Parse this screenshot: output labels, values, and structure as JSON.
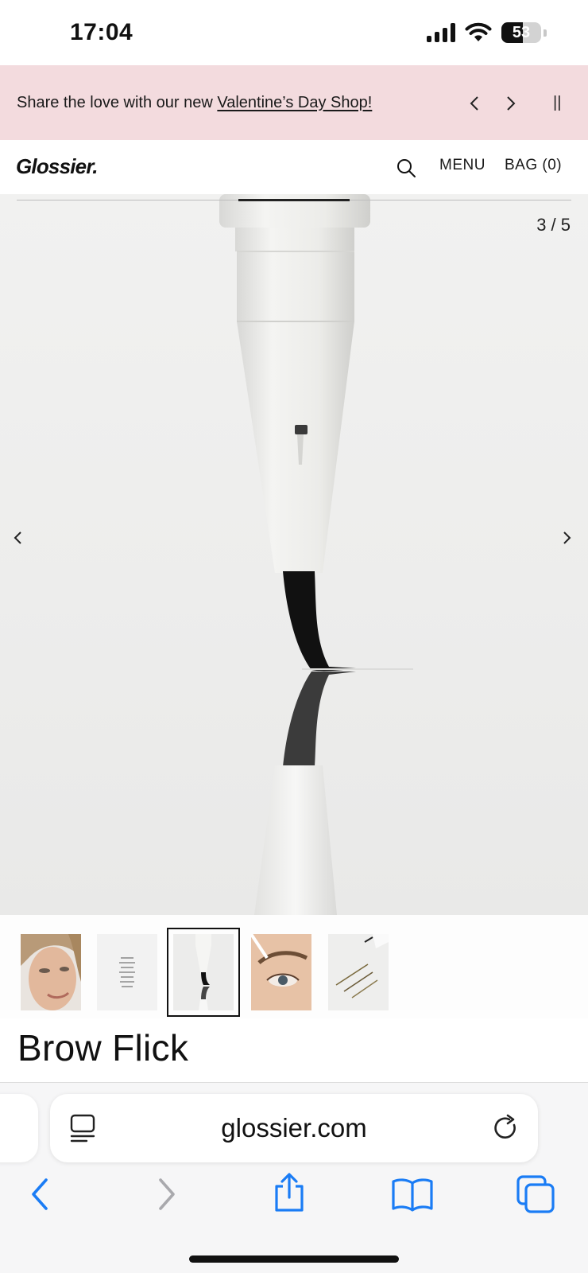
{
  "status_bar": {
    "time": "17:04",
    "battery_level": "53"
  },
  "promo_banner": {
    "text_prefix": "Share the love with our new ",
    "link_text": "Valentine’s Day Shop!",
    "prev_glyph": "‹",
    "next_glyph": "›",
    "pause_glyph": "||",
    "background": "#f3dbde"
  },
  "header": {
    "logo": "Glossier.",
    "menu_label": "MENU",
    "bag_label": "BAG (0)"
  },
  "gallery": {
    "counter": "3 / 5",
    "current": 3,
    "total": 5,
    "prev_glyph": "‹",
    "next_glyph": "›"
  },
  "product": {
    "title": "Brow Flick"
  },
  "browser": {
    "url": "glossier.com",
    "accent": "#1a7cf5"
  }
}
